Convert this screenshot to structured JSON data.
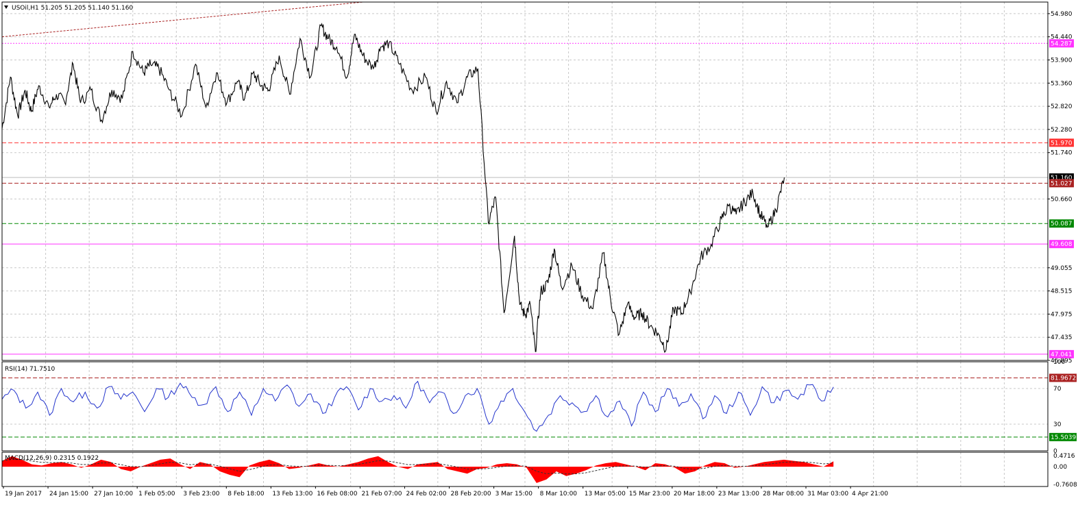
{
  "symbol_header": "USOil,H1  51.205 51.205 51.140 51.160",
  "colors": {
    "background": "#ffffff",
    "grid": "#c8c8c8",
    "price_line": "#000000",
    "rsi_line": "#2233cc",
    "macd_hist": "#ff0000",
    "macd_signal": "#333333",
    "red_level": "#ff3333",
    "dark_red_level": "#aa2222",
    "green_level": "#008800",
    "magenta_level": "#ff33ff",
    "trendline": "#aa2222"
  },
  "chart_data": [
    {
      "type": "line",
      "title": "USOil,H1  51.205 51.205 51.140 51.160",
      "ylim": [
        46.895,
        55.25
      ],
      "y_ticks": [
        "54.980",
        "54.440",
        "53.900",
        "53.360",
        "52.820",
        "52.280",
        "51.740",
        "50.660",
        "49.055",
        "48.515",
        "47.975",
        "47.435",
        "46.895"
      ],
      "x_ticks": [
        "19 Jan 2017",
        "24 Jan 15:00",
        "27 Jan 10:00",
        "1 Feb 05:00",
        "3 Feb 23:00",
        "8 Feb 18:00",
        "13 Feb 13:00",
        "16 Feb 08:00",
        "21 Feb 07:00",
        "24 Feb 02:00",
        "28 Feb 20:00",
        "3 Mar 15:00",
        "8 Mar 10:00",
        "13 Mar 05:00",
        "15 Mar 23:00",
        "20 Mar 18:00",
        "23 Mar 13:00",
        "28 Mar 08:00",
        "31 Mar 03:00",
        "4 Apr 21:00"
      ],
      "levels": [
        {
          "value": 54.287,
          "label": "54.287",
          "style": "dotted",
          "color": "#ff33ff"
        },
        {
          "value": 51.97,
          "label": "51.970",
          "style": "dashed",
          "color": "#ff3333"
        },
        {
          "value": 51.16,
          "label": "51.160",
          "style": "solid",
          "color": "#bbbbbb"
        },
        {
          "value": 51.027,
          "label": "51.027",
          "style": "dashed",
          "color": "#aa2222"
        },
        {
          "value": 50.087,
          "label": "50.087",
          "style": "dashed",
          "color": "#008800"
        },
        {
          "value": 49.608,
          "label": "49.608",
          "style": "solid",
          "color": "#ff33ff"
        },
        {
          "value": 47.041,
          "label": "47.041",
          "style": "solid",
          "color": "#ff33ff"
        }
      ],
      "trendline": [
        [
          0,
          54.44
        ],
        [
          0.345,
          55.25
        ]
      ],
      "series": [
        {
          "x": [
            0,
            0.008,
            0.015,
            0.022,
            0.028,
            0.035,
            0.045,
            0.052,
            0.06,
            0.068,
            0.075,
            0.085,
            0.095,
            0.105,
            0.115,
            0.125,
            0.135,
            0.142,
            0.15,
            0.16,
            0.172,
            0.185,
            0.195,
            0.205,
            0.215,
            0.225,
            0.232,
            0.24,
            0.248,
            0.255,
            0.265,
            0.275,
            0.285,
            0.295,
            0.305,
            0.312,
            0.32,
            0.33,
            0.337,
            0.345,
            0.355,
            0.362,
            0.37,
            0.38,
            0.392,
            0.405,
            0.415,
            0.425,
            0.435,
            0.445,
            0.455,
            0.465,
            0.472,
            0.48,
            0.49,
            0.495,
            0.5,
            0.505,
            0.51,
            0.515,
            0.522,
            0.528,
            0.535,
            0.545,
            0.555,
            0.565,
            0.575,
            0.582,
            0.59,
            0.598,
            0.605,
            0.612,
            0.62,
            0.628,
            0.635,
            0.642,
            0.65,
            0.658,
            0.668,
            0.678,
            0.688,
            0.695,
            0.702,
            0.71,
            0.718,
            0.725,
            0.732,
            0.74,
            0.748,
            0.755,
            0.762,
            0.77,
            0.778,
            0.785,
            0.79,
            0.795,
            0.8,
            0.805,
            0.812,
            0.818,
            0.825,
            0.832,
            0.838,
            0.845,
            0.852,
            0.858,
            0.865,
            0.872,
            0.88,
            0.888,
            0.895,
            0.902,
            0.91
          ],
          "values": [
            52.3,
            53.5,
            52.6,
            53.2,
            52.7,
            53.3,
            52.8,
            53.1,
            52.9,
            53.8,
            52.9,
            53.2,
            52.5,
            53.2,
            53.0,
            54.1,
            53.6,
            53.8,
            53.7,
            53.2,
            52.6,
            53.8,
            52.8,
            53.6,
            52.9,
            53.4,
            53.0,
            53.6,
            53.3,
            53.2,
            54.0,
            53.1,
            54.4,
            53.5,
            54.7,
            54.4,
            54.2,
            53.5,
            54.5,
            54.0,
            53.7,
            54.2,
            54.3,
            53.8,
            53.2,
            53.5,
            52.7,
            53.4,
            52.9,
            53.5,
            53.7,
            50.1,
            50.7,
            48.0,
            49.8,
            48.2,
            47.95,
            48.2,
            47.1,
            48.5,
            48.7,
            49.5,
            48.6,
            49.1,
            48.4,
            48.1,
            49.4,
            48.3,
            47.5,
            48.2,
            47.9,
            48.0,
            47.7,
            47.5,
            47.15,
            48.1,
            48.0,
            48.5,
            49.3,
            49.6,
            50.2,
            50.5,
            50.3,
            50.6,
            50.8,
            50.3,
            50.0,
            50.4,
            51.16,
            51.16,
            51.16,
            51.16,
            51.16,
            51.16,
            51.16,
            51.16,
            51.16,
            51.16,
            51.16,
            51.16,
            51.16,
            51.16,
            51.16,
            51.16,
            51.16,
            51.16,
            51.16,
            51.16,
            51.16,
            51.16,
            51.16,
            51.16,
            51.16
          ]
        }
      ]
    },
    {
      "type": "line",
      "title": "RSI(14) 71.7510",
      "ylim": [
        0,
        100
      ],
      "y_ticks": [
        "100",
        "70",
        "30",
        "0"
      ],
      "levels": [
        {
          "value": 81.9672,
          "label": "81.9672",
          "color": "#aa2222"
        },
        {
          "value": 15.5039,
          "label": "15.5039",
          "color": "#008800"
        }
      ],
      "series": [
        {
          "name": "RSI(14)",
          "values": [
            58,
            68,
            48,
            66,
            40,
            70,
            55,
            66,
            48,
            72,
            58,
            66,
            44,
            70,
            60,
            76,
            60,
            52,
            72,
            44,
            66,
            40,
            70,
            56,
            74,
            50,
            64,
            42,
            60,
            72,
            46,
            70,
            56,
            62,
            48,
            78,
            54,
            66,
            42,
            62,
            70,
            30,
            56,
            70,
            44,
            22,
            40,
            62,
            54,
            44,
            62,
            38,
            56,
            28,
            66,
            44,
            70,
            50,
            64,
            36,
            62,
            42,
            66,
            40,
            72,
            54,
            68,
            58,
            74,
            56,
            71.751
          ]
        }
      ]
    },
    {
      "type": "area",
      "title": "MACD(12,26,9) 0.2315 0.1922",
      "ylim": [
        -0.85,
        0.62
      ],
      "y_ticks": [
        "0.4716",
        "0.00",
        "-0.7608"
      ],
      "series": [
        {
          "name": "MACD(12,26,9)",
          "values": [
            0.25,
            0.45,
            0.3,
            0.1,
            0.05,
            0.15,
            0.2,
            0.1,
            -0.05,
            0.1,
            0.3,
            0.2,
            -0.1,
            -0.2,
            0.0,
            0.15,
            0.3,
            0.35,
            0.1,
            -0.1,
            0.2,
            0.1,
            -0.2,
            -0.35,
            -0.45,
            0.05,
            0.2,
            0.3,
            0.15,
            -0.1,
            -0.05,
            0.05,
            0.15,
            0.05,
            0.0,
            0.1,
            0.2,
            0.35,
            0.45,
            0.2,
            0.0,
            -0.1,
            0.1,
            0.15,
            0.2,
            -0.1,
            -0.2,
            -0.3,
            -0.1,
            -0.05,
            0.1,
            0.15,
            0.1,
            -0.05,
            -0.7,
            -0.55,
            -0.2,
            -0.4,
            -0.3,
            -0.15,
            0.05,
            0.15,
            0.2,
            0.1,
            0.0,
            -0.15,
            0.15,
            0.1,
            -0.05,
            -0.3,
            -0.2,
            0.05,
            0.2,
            0.15,
            -0.05,
            0.0,
            0.1,
            0.2,
            0.25,
            0.3,
            0.25,
            0.2,
            0.1,
            0.0,
            0.2315
          ]
        },
        {
          "name": "signal",
          "values": [
            0.1922
          ]
        }
      ]
    }
  ]
}
